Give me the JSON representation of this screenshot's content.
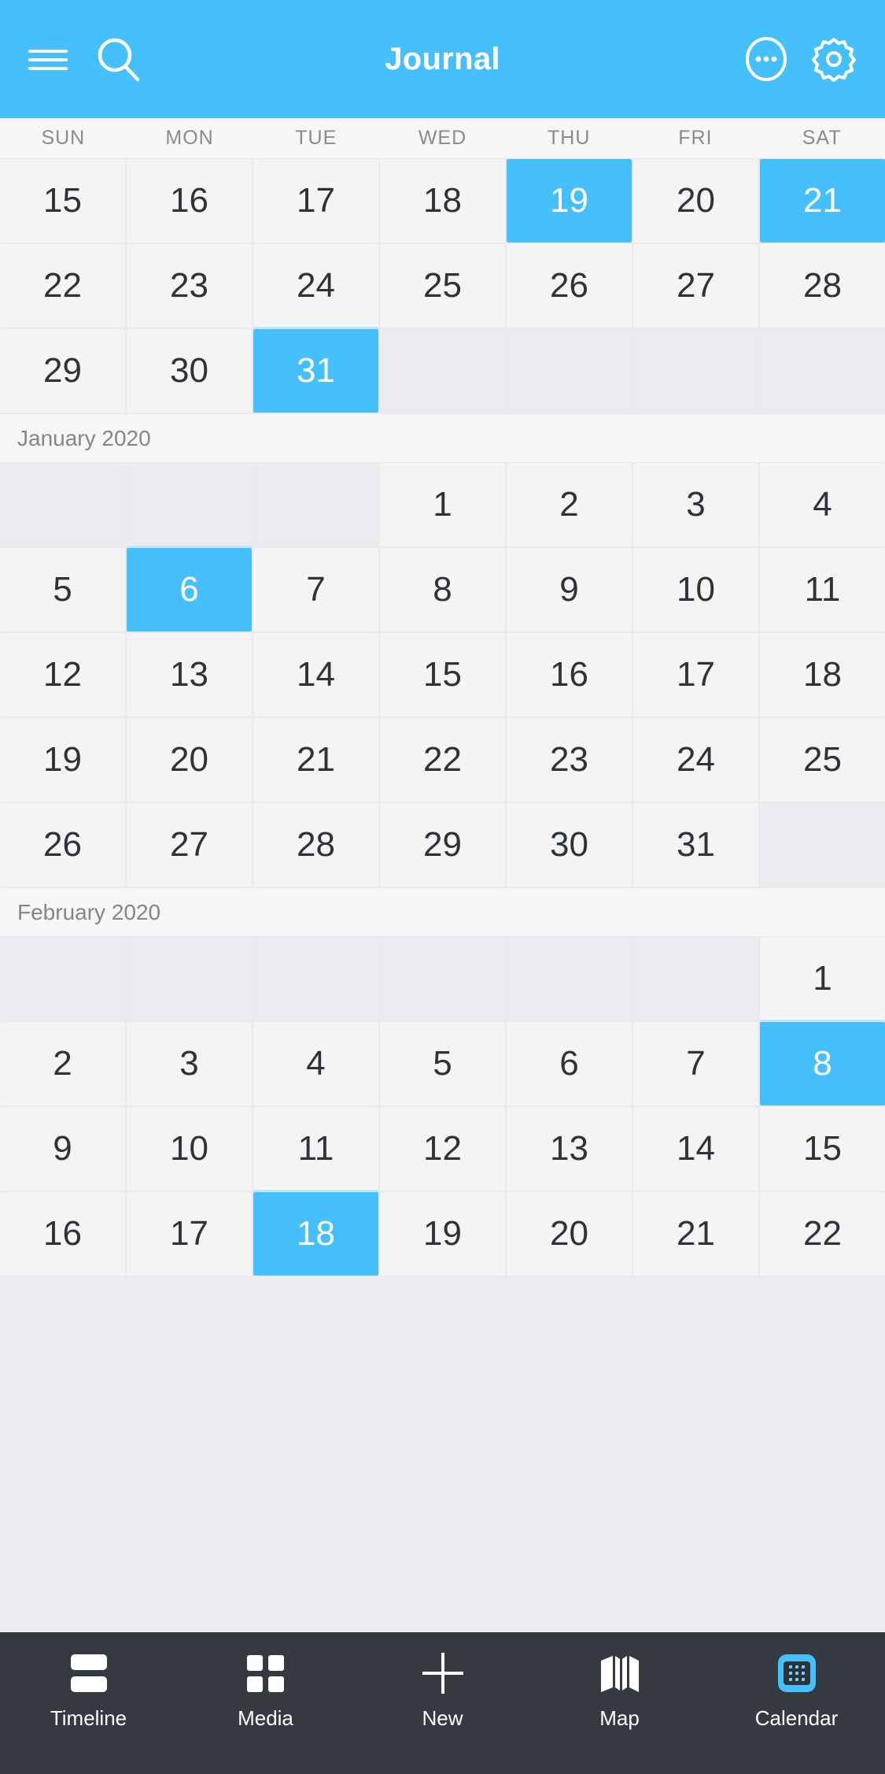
{
  "header": {
    "title": "Journal",
    "menu_icon": "hamburger-menu-icon",
    "search_icon": "search-icon",
    "more_icon": "circle-ellipsis-icon",
    "settings_icon": "gear-icon",
    "background_color": "#46c0fd"
  },
  "weekdays": [
    "SUN",
    "MON",
    "TUE",
    "WED",
    "THU",
    "FRI",
    "SAT"
  ],
  "calendar": {
    "accent_color": "#46c0fd",
    "cell_color": "#f4f4f5",
    "empty_cell_color": "#ebebf0",
    "sections": [
      {
        "month_label": null,
        "weeks": [
          [
            {
              "day": "15",
              "selected": false,
              "empty": false
            },
            {
              "day": "16",
              "selected": false,
              "empty": false
            },
            {
              "day": "17",
              "selected": false,
              "empty": false
            },
            {
              "day": "18",
              "selected": false,
              "empty": false
            },
            {
              "day": "19",
              "selected": true,
              "empty": false
            },
            {
              "day": "20",
              "selected": false,
              "empty": false
            },
            {
              "day": "21",
              "selected": true,
              "empty": false
            }
          ],
          [
            {
              "day": "22",
              "selected": false,
              "empty": false
            },
            {
              "day": "23",
              "selected": false,
              "empty": false
            },
            {
              "day": "24",
              "selected": false,
              "empty": false
            },
            {
              "day": "25",
              "selected": false,
              "empty": false
            },
            {
              "day": "26",
              "selected": false,
              "empty": false
            },
            {
              "day": "27",
              "selected": false,
              "empty": false
            },
            {
              "day": "28",
              "selected": false,
              "empty": false
            }
          ],
          [
            {
              "day": "29",
              "selected": false,
              "empty": false
            },
            {
              "day": "30",
              "selected": false,
              "empty": false
            },
            {
              "day": "31",
              "selected": true,
              "empty": false
            },
            {
              "day": "",
              "selected": false,
              "empty": true
            },
            {
              "day": "",
              "selected": false,
              "empty": true
            },
            {
              "day": "",
              "selected": false,
              "empty": true
            },
            {
              "day": "",
              "selected": false,
              "empty": true
            }
          ]
        ]
      },
      {
        "month_label": "January 2020",
        "weeks": [
          [
            {
              "day": "",
              "selected": false,
              "empty": true
            },
            {
              "day": "",
              "selected": false,
              "empty": true
            },
            {
              "day": "",
              "selected": false,
              "empty": true
            },
            {
              "day": "1",
              "selected": false,
              "empty": false
            },
            {
              "day": "2",
              "selected": false,
              "empty": false
            },
            {
              "day": "3",
              "selected": false,
              "empty": false
            },
            {
              "day": "4",
              "selected": false,
              "empty": false
            }
          ],
          [
            {
              "day": "5",
              "selected": false,
              "empty": false
            },
            {
              "day": "6",
              "selected": true,
              "empty": false
            },
            {
              "day": "7",
              "selected": false,
              "empty": false
            },
            {
              "day": "8",
              "selected": false,
              "empty": false
            },
            {
              "day": "9",
              "selected": false,
              "empty": false
            },
            {
              "day": "10",
              "selected": false,
              "empty": false
            },
            {
              "day": "11",
              "selected": false,
              "empty": false
            }
          ],
          [
            {
              "day": "12",
              "selected": false,
              "empty": false
            },
            {
              "day": "13",
              "selected": false,
              "empty": false
            },
            {
              "day": "14",
              "selected": false,
              "empty": false
            },
            {
              "day": "15",
              "selected": false,
              "empty": false
            },
            {
              "day": "16",
              "selected": false,
              "empty": false
            },
            {
              "day": "17",
              "selected": false,
              "empty": false
            },
            {
              "day": "18",
              "selected": false,
              "empty": false
            }
          ],
          [
            {
              "day": "19",
              "selected": false,
              "empty": false
            },
            {
              "day": "20",
              "selected": false,
              "empty": false
            },
            {
              "day": "21",
              "selected": false,
              "empty": false
            },
            {
              "day": "22",
              "selected": false,
              "empty": false
            },
            {
              "day": "23",
              "selected": false,
              "empty": false
            },
            {
              "day": "24",
              "selected": false,
              "empty": false
            },
            {
              "day": "25",
              "selected": false,
              "empty": false
            }
          ],
          [
            {
              "day": "26",
              "selected": false,
              "empty": false
            },
            {
              "day": "27",
              "selected": false,
              "empty": false
            },
            {
              "day": "28",
              "selected": false,
              "empty": false
            },
            {
              "day": "29",
              "selected": false,
              "empty": false
            },
            {
              "day": "30",
              "selected": false,
              "empty": false
            },
            {
              "day": "31",
              "selected": false,
              "empty": false
            },
            {
              "day": "",
              "selected": false,
              "empty": true
            }
          ]
        ]
      },
      {
        "month_label": "February 2020",
        "weeks": [
          [
            {
              "day": "",
              "selected": false,
              "empty": true
            },
            {
              "day": "",
              "selected": false,
              "empty": true
            },
            {
              "day": "",
              "selected": false,
              "empty": true
            },
            {
              "day": "",
              "selected": false,
              "empty": true
            },
            {
              "day": "",
              "selected": false,
              "empty": true
            },
            {
              "day": "",
              "selected": false,
              "empty": true
            },
            {
              "day": "1",
              "selected": false,
              "empty": false
            }
          ],
          [
            {
              "day": "2",
              "selected": false,
              "empty": false
            },
            {
              "day": "3",
              "selected": false,
              "empty": false
            },
            {
              "day": "4",
              "selected": false,
              "empty": false
            },
            {
              "day": "5",
              "selected": false,
              "empty": false
            },
            {
              "day": "6",
              "selected": false,
              "empty": false
            },
            {
              "day": "7",
              "selected": false,
              "empty": false
            },
            {
              "day": "8",
              "selected": true,
              "empty": false
            }
          ],
          [
            {
              "day": "9",
              "selected": false,
              "empty": false
            },
            {
              "day": "10",
              "selected": false,
              "empty": false
            },
            {
              "day": "11",
              "selected": false,
              "empty": false
            },
            {
              "day": "12",
              "selected": false,
              "empty": false
            },
            {
              "day": "13",
              "selected": false,
              "empty": false
            },
            {
              "day": "14",
              "selected": false,
              "empty": false
            },
            {
              "day": "15",
              "selected": false,
              "empty": false
            }
          ],
          [
            {
              "day": "16",
              "selected": false,
              "empty": false
            },
            {
              "day": "17",
              "selected": false,
              "empty": false
            },
            {
              "day": "18",
              "selected": true,
              "empty": false
            },
            {
              "day": "19",
              "selected": false,
              "empty": false
            },
            {
              "day": "20",
              "selected": false,
              "empty": false
            },
            {
              "day": "21",
              "selected": false,
              "empty": false
            },
            {
              "day": "22",
              "selected": false,
              "empty": false
            }
          ]
        ]
      }
    ]
  },
  "bottom_nav": {
    "background_color": "#343a40",
    "active_index": 4,
    "items": [
      {
        "label": "Timeline",
        "icon": "timeline-icon"
      },
      {
        "label": "Media",
        "icon": "media-grid-icon"
      },
      {
        "label": "New",
        "icon": "plus-icon"
      },
      {
        "label": "Map",
        "icon": "map-icon"
      },
      {
        "label": "Calendar",
        "icon": "calendar-icon"
      }
    ]
  }
}
